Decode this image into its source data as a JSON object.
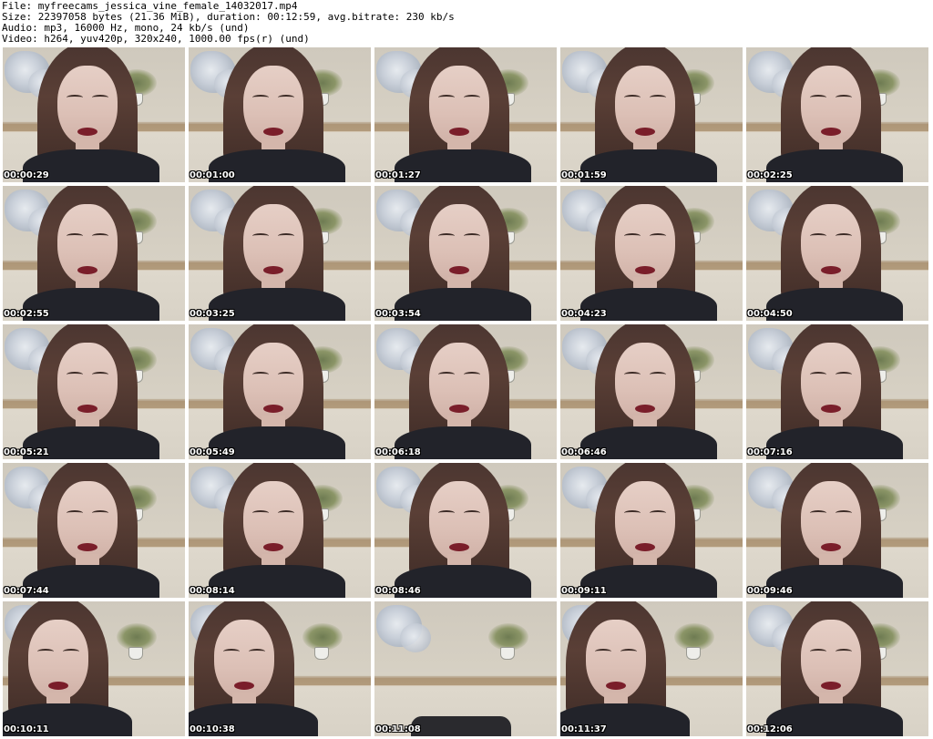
{
  "info": {
    "file": "File: myfreecams_jessica_vine_female_14032017.mp4",
    "size": "Size: 22397058 bytes (21.36 MiB), duration: 00:12:59, avg.bitrate: 230 kb/s",
    "audio": "Audio: mp3, 16000 Hz, mono, 24 kb/s (und)",
    "video": "Video: h264, yuv420p, 320x240, 1000.00 fps(r) (und)"
  },
  "thumbnails": [
    {
      "time": "00:00:29"
    },
    {
      "time": "00:01:00"
    },
    {
      "time": "00:01:27"
    },
    {
      "time": "00:01:59"
    },
    {
      "time": "00:02:25"
    },
    {
      "time": "00:02:55"
    },
    {
      "time": "00:03:25"
    },
    {
      "time": "00:03:54"
    },
    {
      "time": "00:04:23"
    },
    {
      "time": "00:04:50"
    },
    {
      "time": "00:05:21"
    },
    {
      "time": "00:05:49"
    },
    {
      "time": "00:06:18"
    },
    {
      "time": "00:06:46"
    },
    {
      "time": "00:07:16"
    },
    {
      "time": "00:07:44"
    },
    {
      "time": "00:08:14"
    },
    {
      "time": "00:08:46"
    },
    {
      "time": "00:09:11"
    },
    {
      "time": "00:09:46"
    },
    {
      "time": "00:10:11"
    },
    {
      "time": "00:10:38"
    },
    {
      "time": "00:11:08"
    },
    {
      "time": "00:11:37"
    },
    {
      "time": "00:12:06"
    }
  ]
}
